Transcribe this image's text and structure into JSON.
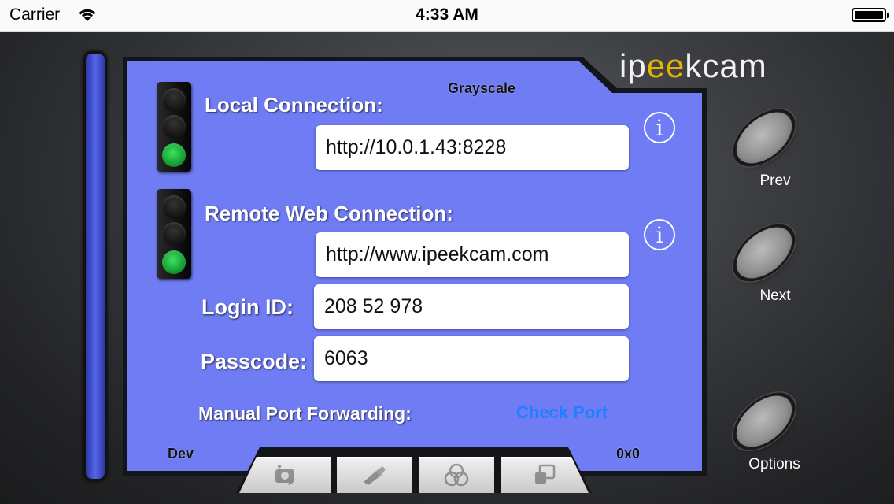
{
  "status_bar": {
    "carrier": "Carrier",
    "time": "4:33 AM"
  },
  "logo": {
    "prefix": "ip",
    "eyes": "ee",
    "suffix": "kcam"
  },
  "panel": {
    "mode": "Grayscale",
    "local": {
      "label": "Local Connection:",
      "url": "http://10.0.1.43:8228",
      "status": "green"
    },
    "remote": {
      "label": "Remote Web Connection:",
      "url": "http://www.ipeekcam.com",
      "status": "green"
    },
    "login": {
      "label": "Login ID:",
      "value": "208 52 978"
    },
    "passcode": {
      "label": "Passcode:",
      "value": "6063"
    },
    "port_forwarding": {
      "label": "Manual Port Forwarding:",
      "check_label": "Check Port"
    },
    "dev_label": "Dev",
    "resolution": "0x0",
    "info_glyph": "i"
  },
  "side_buttons": {
    "prev": "Prev",
    "next": "Next",
    "options": "Options"
  },
  "tabs": [
    {
      "icon": "switch-camera-icon"
    },
    {
      "icon": "flashlight-icon"
    },
    {
      "icon": "color-filter-icon"
    },
    {
      "icon": "resize-window-icon"
    }
  ],
  "colors": {
    "panel": "#6f7cf4",
    "link": "#1e7fff",
    "status_green": "#1fbf3f"
  }
}
